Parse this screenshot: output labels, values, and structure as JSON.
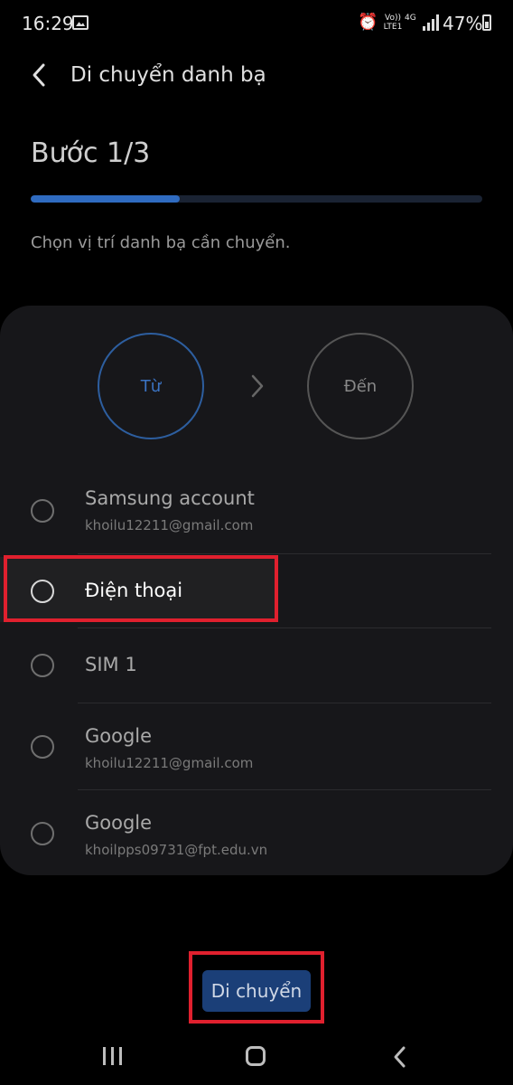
{
  "status_bar": {
    "time": "16:29",
    "volte": "Vo)) LTE1",
    "network": "4G",
    "battery": "47%"
  },
  "header": {
    "title": "Di chuyển danh bạ",
    "step": "Bước 1/3",
    "progress": 0.33,
    "instruction": "Chọn vị trí danh bạ cần chuyển."
  },
  "flow": {
    "from_label": "Từ",
    "to_label": "Đến"
  },
  "sources": [
    {
      "title": "Samsung account",
      "subtitle": "khoilu12211@gmail.com"
    },
    {
      "title": "Điện thoại",
      "subtitle": ""
    },
    {
      "title": "SIM 1",
      "subtitle": ""
    },
    {
      "title": "Google",
      "subtitle": "khoilu12211@gmail.com"
    },
    {
      "title": "Google",
      "subtitle": "khoilpps09731@fpt.edu.vn"
    }
  ],
  "action": {
    "move_label": "Di chuyển"
  },
  "colors": {
    "accent": "#2f6bc0",
    "highlight": "#e0202e",
    "background": "#000000",
    "card": "#17171a"
  }
}
